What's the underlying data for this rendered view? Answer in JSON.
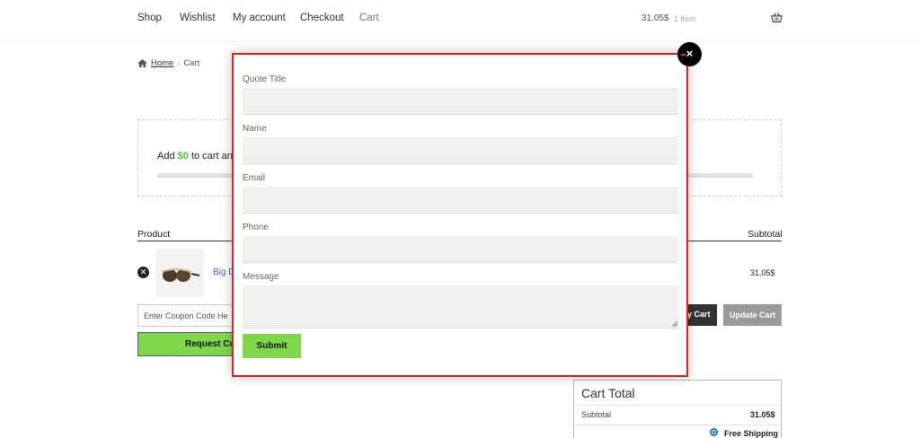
{
  "header": {
    "nav": [
      {
        "label": "Shop"
      },
      {
        "label": "Wishlist"
      },
      {
        "label": "My account"
      },
      {
        "label": "Checkout"
      },
      {
        "label": "Cart"
      }
    ],
    "cart_total": "31.05$",
    "cart_count": "1 item",
    "basket_icon": "basket-icon"
  },
  "breadcrumb": {
    "home": "Home",
    "current": "Cart"
  },
  "notice": {
    "prefix": "Add ",
    "amount": "$0",
    "suffix": " to cart an"
  },
  "table": {
    "product_header": "Product",
    "subtotal_header": "Subtotal",
    "product_link": "Big D",
    "subtotal_value": "31.05$"
  },
  "coupon": {
    "placeholder": "Enter Coupon Code He"
  },
  "buttons": {
    "request": "Request Cu",
    "apply": "y Cart",
    "update": "Update Cart"
  },
  "totals": {
    "title": "Cart Total",
    "subtotal_label": "Subtotal",
    "subtotal_value": "31.05$",
    "shipping": "Free Shipping"
  },
  "modal": {
    "close_label": "×",
    "fields": {
      "quote_title": "Quote Title",
      "name": "Name",
      "email": "Email",
      "phone": "Phone",
      "message": "Message"
    },
    "submit": "Submit"
  },
  "colors": {
    "accent_green": "#7fd84a",
    "modal_border": "#e2231a",
    "link": "#3b5fc4"
  }
}
